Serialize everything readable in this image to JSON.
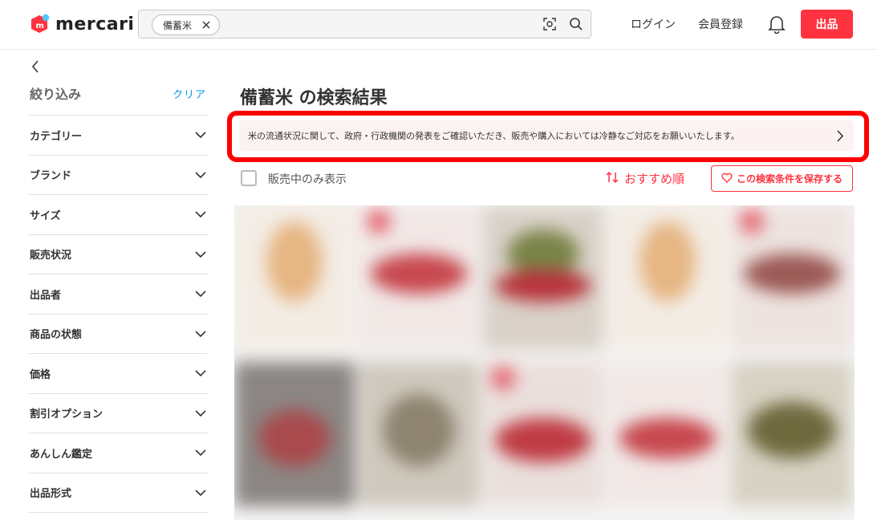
{
  "header": {
    "logo_text": "mercari",
    "search_chip": "備蓄米",
    "login": "ログイン",
    "signup": "会員登録",
    "sell_button": "出品"
  },
  "sidebar": {
    "title": "絞り込み",
    "clear": "クリア",
    "items": [
      {
        "label": "カテゴリー"
      },
      {
        "label": "ブランド"
      },
      {
        "label": "サイズ"
      },
      {
        "label": "販売状況"
      },
      {
        "label": "出品者"
      },
      {
        "label": "商品の状態"
      },
      {
        "label": "価格"
      },
      {
        "label": "割引オプション"
      },
      {
        "label": "あんしん鑑定"
      },
      {
        "label": "出品形式"
      }
    ]
  },
  "main": {
    "title": "備蓄米 の検索結果",
    "notice": "米の流通状況に関して、政府・行政機関の発表をご確認いただき、販売や購入においては冷静なご対応をお願いいたします。",
    "on_sale_only": "販売中のみ表示",
    "sort_label": "おすすめ順",
    "save_search": "この検索条件を保存する"
  },
  "colors": {
    "brand_red": "#ff333f",
    "link_blue": "#0095ee",
    "highlight_outline": "#ff0000",
    "notice_bg": "#fcf2f2"
  },
  "icons": [
    "mercari-logo-icon",
    "close-icon",
    "camera-scan-icon",
    "search-icon",
    "bell-icon",
    "chevron-left-icon",
    "chevron-down-icon",
    "chevron-right-icon",
    "sort-arrows-icon",
    "heart-icon"
  ]
}
